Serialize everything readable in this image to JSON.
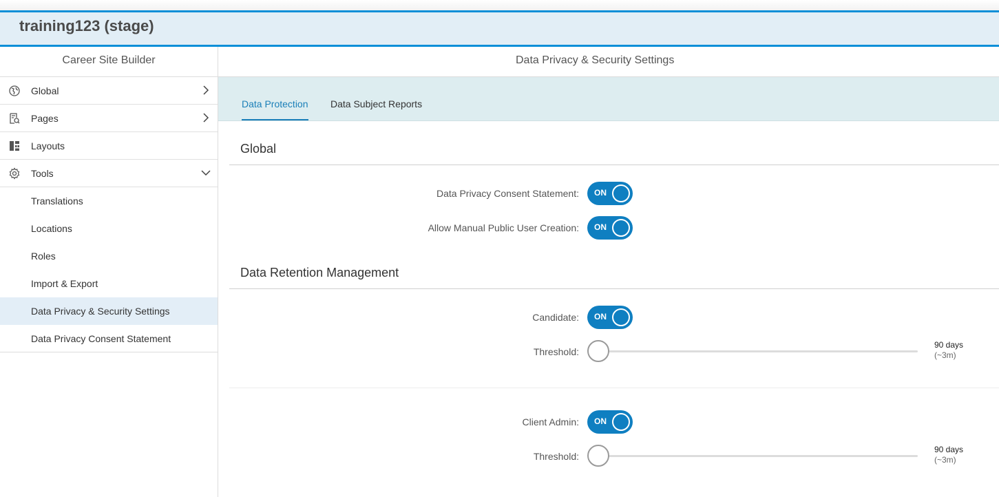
{
  "header": {
    "title": "training123 (stage)"
  },
  "sidebar": {
    "title": "Career Site Builder",
    "items": [
      {
        "label": "Global"
      },
      {
        "label": "Pages"
      },
      {
        "label": "Layouts"
      },
      {
        "label": "Tools"
      }
    ],
    "tools_subitems": [
      {
        "label": "Translations"
      },
      {
        "label": "Locations"
      },
      {
        "label": "Roles"
      },
      {
        "label": "Import & Export"
      },
      {
        "label": "Data Privacy & Security Settings"
      },
      {
        "label": "Data Privacy Consent Statement"
      }
    ]
  },
  "main": {
    "title": "Data Privacy & Security Settings",
    "tabs": [
      {
        "label": "Data Protection"
      },
      {
        "label": "Data Subject Reports"
      }
    ],
    "global": {
      "title": "Global",
      "consent_label": "Data Privacy Consent Statement:",
      "consent_toggle": "ON",
      "manual_user_label": "Allow Manual Public User Creation:",
      "manual_user_toggle": "ON"
    },
    "retention": {
      "title": "Data Retention Management",
      "candidate_label": "Candidate:",
      "candidate_toggle": "ON",
      "candidate_threshold_label": "Threshold:",
      "candidate_threshold_value": "90 days",
      "candidate_threshold_approx": "(~3m)",
      "admin_label": "Client Admin:",
      "admin_toggle": "ON",
      "admin_threshold_label": "Threshold:",
      "admin_threshold_value": "90 days",
      "admin_threshold_approx": "(~3m)"
    }
  },
  "colors": {
    "accent": "#0f7fc1",
    "header_border": "#0a8fd8",
    "tabbar_bg": "#ddedf0"
  }
}
